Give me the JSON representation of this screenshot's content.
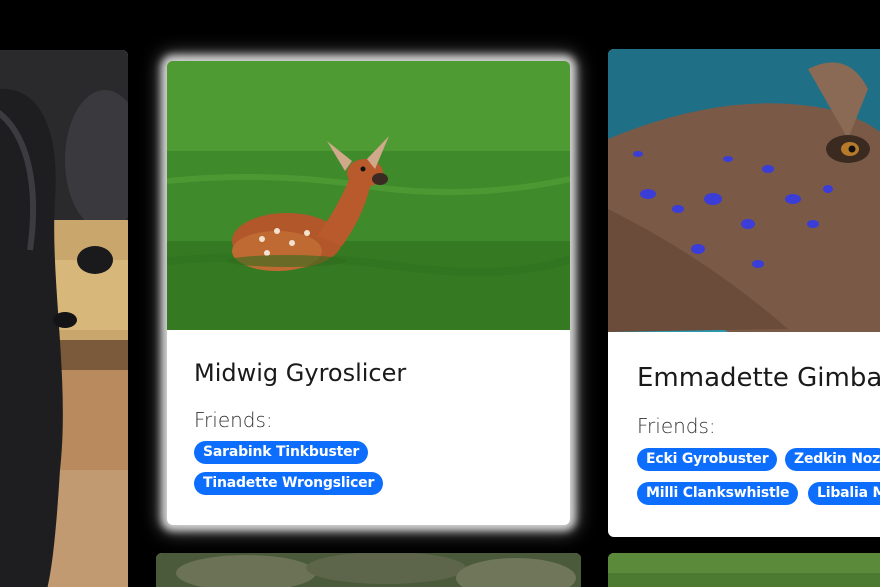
{
  "cards": [
    {
      "name": "",
      "image": "gorilla-photo"
    },
    {
      "name": "Midwig Gyroslicer",
      "image": "deer-fawn-photo",
      "friends_label": "Friends:",
      "friends": [
        "Sarabink Tinkbuster",
        "Tinadette Wrongslicer"
      ]
    },
    {
      "name": "Emmadette Gimbalp",
      "image": "stingray-photo",
      "friends_label": "Friends:",
      "friends": [
        "Ecki Gyrobuster",
        "Zedkin Noz",
        "Milli Clankswhistle",
        "Libalia M"
      ]
    },
    {
      "name": "",
      "image": "rocky-photo"
    },
    {
      "name": "",
      "image": "grass-photo"
    }
  ],
  "colors": {
    "background": "#000000",
    "badge": "#0d6efd",
    "card": "#ffffff",
    "highlight_glow": "#ffffff"
  }
}
